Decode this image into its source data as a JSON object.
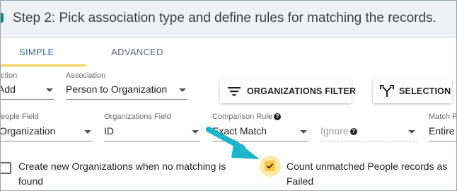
{
  "header": {
    "title": "Step 2: Pick association type and define rules for matching the records."
  },
  "tabs": {
    "simple": "SIMPLE",
    "advanced": "ADVANCED"
  },
  "row1": {
    "action_label": "ction",
    "action_value": "Add",
    "association_label": "Association",
    "association_value": "Person to Organization",
    "filter_button": "ORGANIZATIONS FILTER",
    "selection_button": "SELECTION"
  },
  "row2": {
    "people_field_label": "eople Field",
    "people_field_value": "Organization",
    "org_field_label": "Organizations Field",
    "org_field_value": "ID",
    "comparison_label": "Comparison Rule",
    "comparison_value": "Exact Match",
    "ignore_value": "Ignore",
    "match_label": "Match P",
    "match_value": "Entire"
  },
  "options": {
    "create_new": "Create new Organizations when no matching is found",
    "count_unmatched": "Count unmatched People records as Failed",
    "count_unmatched_checked": true,
    "create_new_checked": false
  },
  "colors": {
    "accent": "#f2d15a",
    "arrow": "#1cb5c9",
    "tab_active": "#3d6a94"
  }
}
